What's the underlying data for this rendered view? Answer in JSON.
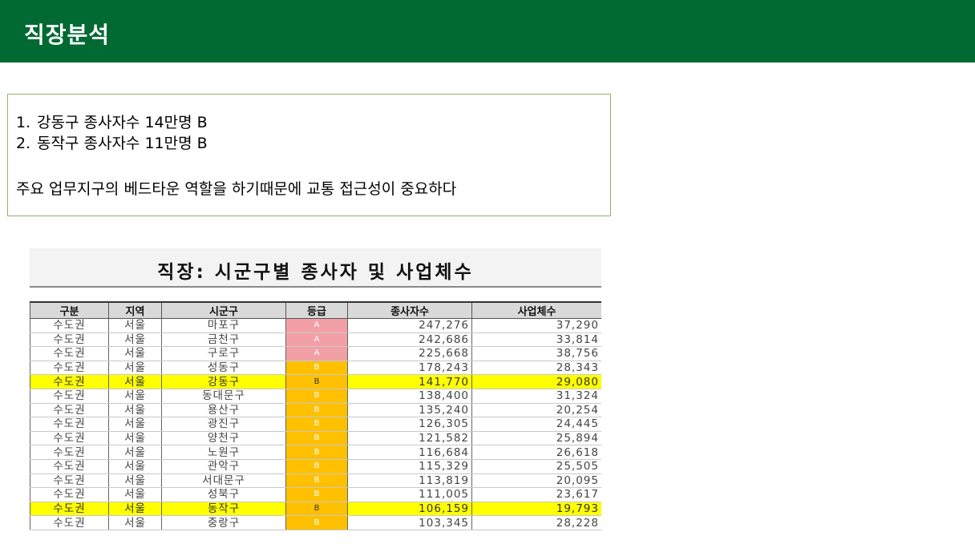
{
  "slide": {
    "title": "직장분석"
  },
  "summary": {
    "items": [
      {
        "num": "1.",
        "text": "강동구 종사자수 14만명 B"
      },
      {
        "num": "2.",
        "text": "동작구 종사자수 11만명 B"
      }
    ],
    "note": "주요 업무지구의 베드타운 역할을 하기때문에 교통 접근성이 중요하다"
  },
  "table": {
    "title": "직장: 시군구별 종사자 및 사업체수",
    "headers": [
      "구분",
      "지역",
      "시군구",
      "등급",
      "종사자수",
      "사업체수"
    ],
    "highlight_color": "#ffff00",
    "grade_colors": {
      "A": "#f2a0a6",
      "B": "#ffc000"
    },
    "rows": [
      {
        "region_group": "수도권",
        "region": "서울",
        "district": "마포구",
        "grade": "A",
        "workers": "247,276",
        "businesses": "37,290",
        "highlight": false
      },
      {
        "region_group": "수도권",
        "region": "서울",
        "district": "금천구",
        "grade": "A",
        "workers": "242,686",
        "businesses": "33,814",
        "highlight": false
      },
      {
        "region_group": "수도권",
        "region": "서울",
        "district": "구로구",
        "grade": "A",
        "workers": "225,668",
        "businesses": "38,756",
        "highlight": false
      },
      {
        "region_group": "수도권",
        "region": "서울",
        "district": "성동구",
        "grade": "B",
        "workers": "178,243",
        "businesses": "28,343",
        "highlight": false
      },
      {
        "region_group": "수도권",
        "region": "서울",
        "district": "강동구",
        "grade": "B",
        "workers": "141,770",
        "businesses": "29,080",
        "highlight": true
      },
      {
        "region_group": "수도권",
        "region": "서울",
        "district": "동대문구",
        "grade": "B",
        "workers": "138,400",
        "businesses": "31,324",
        "highlight": false
      },
      {
        "region_group": "수도권",
        "region": "서울",
        "district": "용산구",
        "grade": "B",
        "workers": "135,240",
        "businesses": "20,254",
        "highlight": false
      },
      {
        "region_group": "수도권",
        "region": "서울",
        "district": "광진구",
        "grade": "B",
        "workers": "126,305",
        "businesses": "24,445",
        "highlight": false
      },
      {
        "region_group": "수도권",
        "region": "서울",
        "district": "양천구",
        "grade": "B",
        "workers": "121,582",
        "businesses": "25,894",
        "highlight": false
      },
      {
        "region_group": "수도권",
        "region": "서울",
        "district": "노원구",
        "grade": "B",
        "workers": "116,684",
        "businesses": "26,618",
        "highlight": false
      },
      {
        "region_group": "수도권",
        "region": "서울",
        "district": "관악구",
        "grade": "B",
        "workers": "115,329",
        "businesses": "25,505",
        "highlight": false
      },
      {
        "region_group": "수도권",
        "region": "서울",
        "district": "서대문구",
        "grade": "B",
        "workers": "113,819",
        "businesses": "20,095",
        "highlight": false
      },
      {
        "region_group": "수도권",
        "region": "서울",
        "district": "성북구",
        "grade": "B",
        "workers": "111,005",
        "businesses": "23,617",
        "highlight": false
      },
      {
        "region_group": "수도권",
        "region": "서울",
        "district": "동작구",
        "grade": "B",
        "workers": "106,159",
        "businesses": "19,793",
        "highlight": true
      },
      {
        "region_group": "수도권",
        "region": "서울",
        "district": "중랑구",
        "grade": "B",
        "workers": "103,345",
        "businesses": "28,228",
        "highlight": false
      }
    ]
  }
}
